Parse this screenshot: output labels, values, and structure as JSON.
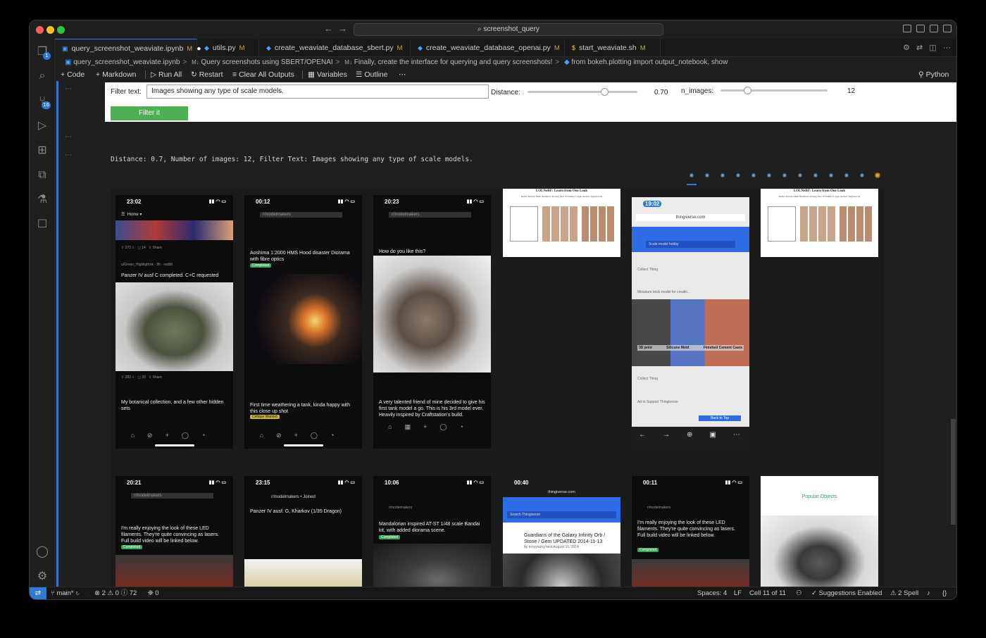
{
  "window": {
    "title": "screenshot_query"
  },
  "tabs": [
    {
      "label": "query_screenshot_weaviate.ipynb",
      "status": "M",
      "active": true
    },
    {
      "label": "utils.py",
      "status": "M"
    },
    {
      "label": "create_weaviate_database_sbert.py",
      "status": "M"
    },
    {
      "label": "create_weaviate_database_openai.py",
      "status": "M"
    },
    {
      "label": "start_weaviate.sh",
      "status": "M"
    }
  ],
  "breadcrumb": [
    "query_screenshot_weaviate.ipynb",
    "Query screenshots using SBERT/OPENAI",
    "Finally, create the interface for querying and query screenshots!",
    "from bokeh.plotting import output_notebook, show"
  ],
  "toolbar": {
    "code": "Code",
    "markdown": "Markdown",
    "run_all": "Run All",
    "restart": "Restart",
    "clear": "Clear All Outputs",
    "variables": "Variables",
    "outline": "Outline",
    "kernel": "Python"
  },
  "activity_badges": {
    "explorer": "1",
    "source_control": "16"
  },
  "widgets": {
    "filter_label": "Filter text:",
    "filter_value": "Images showing any type of scale models.",
    "distance_label": "Distance:",
    "distance_value": "0.70",
    "distance_fraction": 0.7,
    "nimages_label": "n_images:",
    "nimages_value": "12",
    "nimages_fraction": 0.25,
    "button": "Filter it"
  },
  "output_text": "Distance: 0.7, Number of images: 12, Filter Text: Images showing any type of scale models.",
  "gallery": {
    "row1": [
      {
        "time": "23:02",
        "header": "Home",
        "title": "Panzer IV ausf C completed. C+C requested",
        "sub": "u/Green_Highlight nk · 9h · reddit",
        "footer": "My botanical collection, and a few other hidden sets"
      },
      {
        "time": "00:12",
        "header": "r/modelmakers",
        "title": "Aoshima 1:2000 HMS Hood disaster Diorama with fibre optics",
        "tag": "Completed",
        "footer": "First time weathering a tank, kinda happy with this close up shot",
        "tag2": "Critique Wanted"
      },
      {
        "time": "20:23",
        "header": "r/modelmakers",
        "title": "How do you like this?",
        "footer": "A very talented friend of mine decided to give his first tank model a go. This is his 3rd model ever. Heavily inspired by Craftstation's build."
      },
      {
        "paper_title": "LOLNeRF: Learn from One Look",
        "paper_authors": "Daniel Rebain  Mark Matthews  Kwang Moo Yi  Dmitry Lagun  Andrea Tagliasacchi"
      },
      {
        "time": "19:02",
        "url": "thingiverse.com",
        "search": "Scale model hobby",
        "item": "Miniature brick model for creatin...",
        "labels": [
          "3D print",
          "Silicone Mold",
          "Finished Cement Casts"
        ],
        "action": "Collect Thing",
        "ad": "Ad to Support Thingiverse",
        "back": "Back to Top"
      },
      {
        "paper_title": "LOLNeRF: Learn from One Look",
        "paper_authors": "Daniel Rebain  Mark Matthews  Kwang Moo Yi  Dmitry Lagun  Andrea Tagliasacchi"
      }
    ],
    "row2": [
      {
        "time": "20:21",
        "header": "r/modelmakers",
        "title": "I'm really enjoying the look of these LED filaments. They're quite convincing as lasers. Full build video will be linked below.",
        "tag": "Completed"
      },
      {
        "time": "23:15",
        "header": "r/modelmakers • Joined",
        "title": "Panzer IV ausf. G, Kharkov (1/35 Dragon)"
      },
      {
        "time": "10:06",
        "header": "r/modelmakers",
        "title": "Mandalorian inspired AT-ST 1/48 scale Bandai kit, with added diorama scene.",
        "tag": "Completed"
      },
      {
        "time": "00:40",
        "url": "thingiverse.com",
        "search": "Search Thingiverse",
        "title": "Guardians of the Galaxy Infinity Orb / Stone / Gem UPDATED 2014-11-13",
        "by": "by tonyyoung’nest  August 16, 2014"
      },
      {
        "time": "00:11",
        "header": "r/modelmakers",
        "title": "I'm really enjoying the look of these LED filaments. They're quite convincing as lasers. Full build video will be linked below.",
        "tag": "Completed"
      },
      {
        "title": "Popular Objects"
      }
    ]
  },
  "statusbar": {
    "branch": "main*",
    "problems": "⊗ 2 ⚠ 0 ⓘ 72",
    "ports": "⛯ 0",
    "spaces": "Spaces: 4",
    "eol": "LF",
    "cell": "Cell 11 of 11",
    "suggestions": "✓ Suggestions Enabled",
    "spell": "⚠ 2 Spell"
  },
  "colors": {
    "accent": "#2f7ad6",
    "button": "#4caf50",
    "modified": "#c9a44a"
  }
}
